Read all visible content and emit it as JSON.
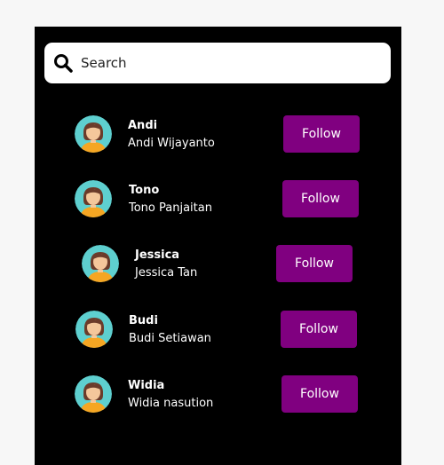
{
  "search": {
    "placeholder": "Search"
  },
  "users": [
    {
      "short_name": "Andi",
      "full_name": "Andi Wijayanto",
      "follow_label": "Follow"
    },
    {
      "short_name": "Tono",
      "full_name": "Tono Panjaitan",
      "follow_label": "Follow"
    },
    {
      "short_name": "Jessica",
      "full_name": "Jessica Tan",
      "follow_label": "Follow"
    },
    {
      "short_name": "Budi",
      "full_name": "Budi Setiawan",
      "follow_label": "Follow"
    },
    {
      "short_name": "Widia",
      "full_name": "Widia nasution",
      "follow_label": "Follow"
    }
  ],
  "colors": {
    "panel_background": "#000000",
    "follow_button": "#800080",
    "avatar_background": "#5ecfcf",
    "avatar_hair": "#6b3b2a",
    "avatar_shirt": "#f5a623"
  },
  "icons": {
    "search": "search-icon",
    "avatar": "avatar-icon"
  }
}
